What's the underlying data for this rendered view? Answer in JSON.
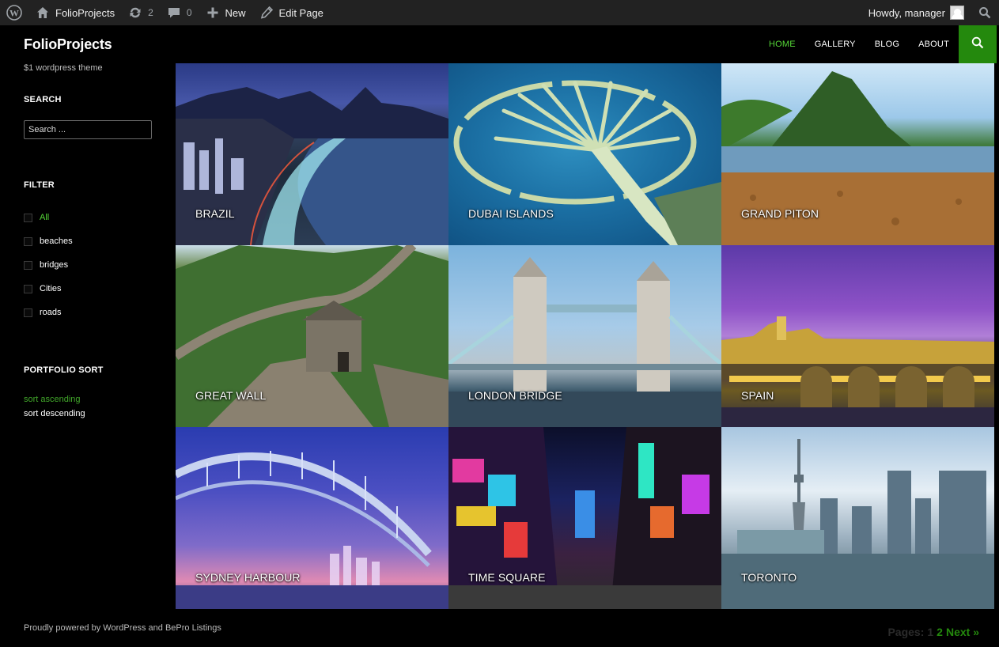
{
  "adminbar": {
    "site_name": "FolioProjects",
    "updates_count": "2",
    "comments_count": "0",
    "new_label": "New",
    "edit_label": "Edit Page",
    "howdy": "Howdy, manager"
  },
  "site": {
    "title": "FolioProjects",
    "description": "$1 wordpress theme"
  },
  "nav": {
    "items": [
      {
        "label": "HOME",
        "active": true
      },
      {
        "label": "GALLERY"
      },
      {
        "label": "BLOG"
      },
      {
        "label": "ABOUT"
      }
    ],
    "accent": "#24890d",
    "active_color": "#55d737"
  },
  "sidebar": {
    "search_title": "SEARCH",
    "search_placeholder": "Search ...",
    "filter_title": "FILTER",
    "filters": [
      "All",
      "beaches",
      "bridges",
      "Cities",
      "roads"
    ],
    "sort_title": "PORTFOLIO SORT",
    "sort_options": [
      "sort ascending",
      "sort descending"
    ]
  },
  "gallery": {
    "items": [
      {
        "label": "BRAZIL"
      },
      {
        "label": "DUBAI ISLANDS"
      },
      {
        "label": "GRAND PITON"
      },
      {
        "label": "GREAT WALL"
      },
      {
        "label": "LONDON BRIDGE"
      },
      {
        "label": "SPAIN"
      },
      {
        "label": "SYDNEY HARBOUR"
      },
      {
        "label": "TIME SQUARE"
      },
      {
        "label": "TORONTO"
      }
    ]
  },
  "footer": {
    "credit": "Proudly powered by WordPress and BePro Listings",
    "pages_label": "Pages:",
    "page_current": "1",
    "page_next_num": "2",
    "next_label": "Next »"
  }
}
